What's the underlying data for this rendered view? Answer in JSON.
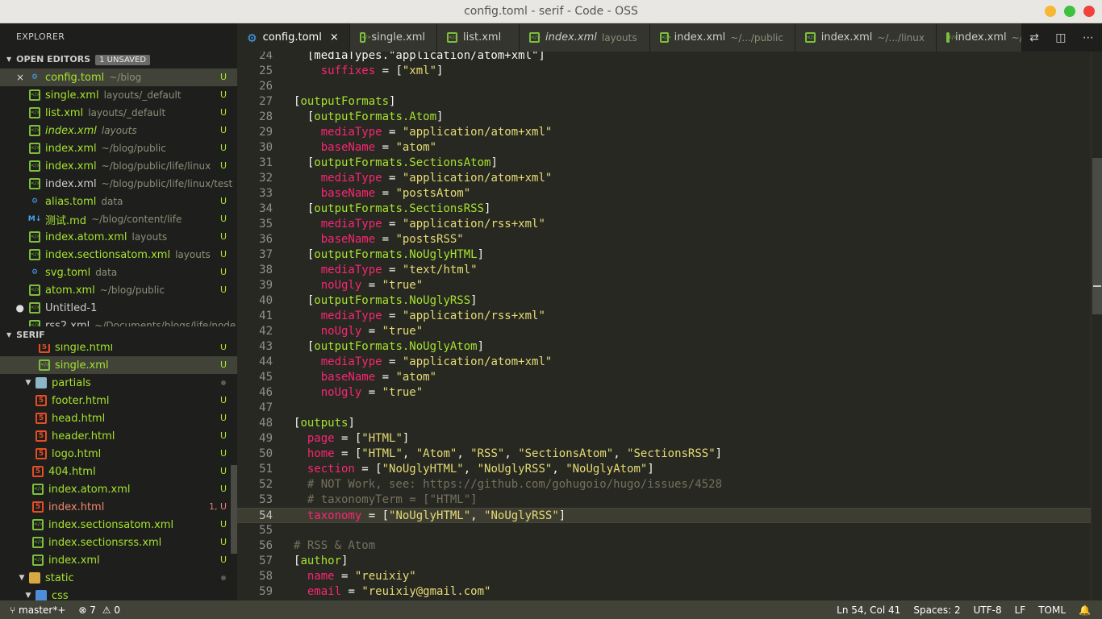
{
  "window": {
    "title": "config.toml - serif - Code - OSS",
    "buttons": {
      "minimize_color": "#f7b733",
      "maximize_color": "#3ec13e",
      "close_color": "#f0413d"
    }
  },
  "sidebar": {
    "title": "EXPLORER",
    "open_editors": {
      "label": "OPEN EDITORS",
      "badge": "1 UNSAVED",
      "items": [
        {
          "name": "config.toml",
          "desc": "~/blog",
          "status": "U",
          "icon": "gear-icon",
          "lead": "×"
        },
        {
          "name": "single.xml",
          "desc": "layouts/_default",
          "status": "U",
          "icon": "xml-icon",
          "lead": ""
        },
        {
          "name": "list.xml",
          "desc": "layouts/_default",
          "status": "U",
          "icon": "xml-icon",
          "lead": ""
        },
        {
          "name": "index.xml",
          "desc": "layouts",
          "status": "U",
          "icon": "xml-icon",
          "lead": ""
        },
        {
          "name": "index.xml",
          "desc": "~/blog/public",
          "status": "U",
          "icon": "xml-icon",
          "lead": ""
        },
        {
          "name": "index.xml",
          "desc": "~/blog/public/life/linux",
          "status": "U",
          "icon": "xml-icon",
          "lead": ""
        },
        {
          "name": "index.xml",
          "desc": "~/blog/public/life/linux/test",
          "status": "",
          "icon": "xml-icon",
          "lead": ""
        },
        {
          "name": "alias.toml",
          "desc": "data",
          "status": "U",
          "icon": "gear-icon",
          "lead": ""
        },
        {
          "name": "测试.md",
          "desc": "~/blog/content/life",
          "status": "U",
          "icon": "markdown-icon",
          "lead": ""
        },
        {
          "name": "index.atom.xml",
          "desc": "layouts",
          "status": "U",
          "icon": "xml-icon",
          "lead": ""
        },
        {
          "name": "index.sectionsatom.xml",
          "desc": "layouts",
          "status": "U",
          "icon": "xml-icon",
          "lead": ""
        },
        {
          "name": "svg.toml",
          "desc": "data",
          "status": "U",
          "icon": "gear-icon",
          "lead": ""
        },
        {
          "name": "atom.xml",
          "desc": "~/blog/public",
          "status": "U",
          "icon": "xml-icon",
          "lead": ""
        },
        {
          "name": "Untitled-1",
          "desc": "",
          "status": "",
          "icon": "xml-icon",
          "lead": "●"
        },
        {
          "name": "rss2.xml",
          "desc": "~/Documents/blogs/life/node_m",
          "status": "",
          "icon": "xml-icon",
          "lead": ""
        }
      ]
    },
    "project": {
      "label": "SERIF",
      "items": [
        {
          "name": "single.html",
          "status": "U",
          "type": "html"
        },
        {
          "name": "single.xml",
          "status": "U",
          "type": "xml"
        },
        {
          "name": "partials",
          "status": "",
          "type": "folder"
        },
        {
          "name": "footer.html",
          "status": "U",
          "type": "html"
        },
        {
          "name": "head.html",
          "status": "U",
          "type": "html"
        },
        {
          "name": "header.html",
          "status": "U",
          "type": "html"
        },
        {
          "name": "logo.html",
          "status": "U",
          "type": "html"
        },
        {
          "name": "404.html",
          "status": "U",
          "type": "html"
        },
        {
          "name": "index.atom.xml",
          "status": "U",
          "type": "xml"
        },
        {
          "name": "index.html",
          "status": "1, U",
          "type": "html"
        },
        {
          "name": "index.sectionsatom.xml",
          "status": "U",
          "type": "xml"
        },
        {
          "name": "index.sectionsrss.xml",
          "status": "U",
          "type": "xml"
        },
        {
          "name": "index.xml",
          "status": "U",
          "type": "xml"
        },
        {
          "name": "static",
          "status": "",
          "type": "folder"
        },
        {
          "name": "css",
          "status": "",
          "type": "folder"
        }
      ]
    }
  },
  "tabs": [
    {
      "name": "config.toml",
      "desc": "",
      "icon": "gear-icon",
      "close": "×"
    },
    {
      "name": "single.xml",
      "desc": "",
      "icon": "xml-icon"
    },
    {
      "name": "list.xml",
      "desc": "",
      "icon": "xml-icon"
    },
    {
      "name": "index.xml",
      "desc": "layouts",
      "icon": "xml-icon"
    },
    {
      "name": "index.xml",
      "desc": "~/.../public",
      "icon": "xml-icon"
    },
    {
      "name": "index.xml",
      "desc": "~/.../linux",
      "icon": "xml-icon"
    },
    {
      "name": "index.xml",
      "desc": "~/",
      "icon": "xml-icon"
    }
  ],
  "editor": {
    "first_line": 24,
    "current_line": 54,
    "lines": [
      [
        {
          "t": "  [mediaTypes.\"application/atom+xml\"]",
          "c": "p"
        }
      ],
      [
        {
          "t": "    ",
          "c": "p"
        },
        {
          "t": "suffixes",
          "c": "k"
        },
        {
          "t": " = [",
          "c": "p"
        },
        {
          "t": "\"xml\"",
          "c": "s"
        },
        {
          "t": "]",
          "c": "p"
        }
      ],
      [],
      [
        {
          "t": "[",
          "c": "p"
        },
        {
          "t": "outputFormats",
          "c": "h"
        },
        {
          "t": "]",
          "c": "p"
        }
      ],
      [
        {
          "t": "  [",
          "c": "p"
        },
        {
          "t": "outputFormats.Atom",
          "c": "h"
        },
        {
          "t": "]",
          "c": "p"
        }
      ],
      [
        {
          "t": "    ",
          "c": "p"
        },
        {
          "t": "mediaType",
          "c": "k"
        },
        {
          "t": " = ",
          "c": "p"
        },
        {
          "t": "\"application/atom+xml\"",
          "c": "s"
        }
      ],
      [
        {
          "t": "    ",
          "c": "p"
        },
        {
          "t": "baseName",
          "c": "k"
        },
        {
          "t": " = ",
          "c": "p"
        },
        {
          "t": "\"atom\"",
          "c": "s"
        }
      ],
      [
        {
          "t": "  [",
          "c": "p"
        },
        {
          "t": "outputFormats.SectionsAtom",
          "c": "h"
        },
        {
          "t": "]",
          "c": "p"
        }
      ],
      [
        {
          "t": "    ",
          "c": "p"
        },
        {
          "t": "mediaType",
          "c": "k"
        },
        {
          "t": " = ",
          "c": "p"
        },
        {
          "t": "\"application/atom+xml\"",
          "c": "s"
        }
      ],
      [
        {
          "t": "    ",
          "c": "p"
        },
        {
          "t": "baseName",
          "c": "k"
        },
        {
          "t": " = ",
          "c": "p"
        },
        {
          "t": "\"postsAtom\"",
          "c": "s"
        }
      ],
      [
        {
          "t": "  [",
          "c": "p"
        },
        {
          "t": "outputFormats.SectionsRSS",
          "c": "h"
        },
        {
          "t": "]",
          "c": "p"
        }
      ],
      [
        {
          "t": "    ",
          "c": "p"
        },
        {
          "t": "mediaType",
          "c": "k"
        },
        {
          "t": " = ",
          "c": "p"
        },
        {
          "t": "\"application/rss+xml\"",
          "c": "s"
        }
      ],
      [
        {
          "t": "    ",
          "c": "p"
        },
        {
          "t": "baseName",
          "c": "k"
        },
        {
          "t": " = ",
          "c": "p"
        },
        {
          "t": "\"postsRSS\"",
          "c": "s"
        }
      ],
      [
        {
          "t": "  [",
          "c": "p"
        },
        {
          "t": "outputFormats.NoUglyHTML",
          "c": "h"
        },
        {
          "t": "]",
          "c": "p"
        }
      ],
      [
        {
          "t": "    ",
          "c": "p"
        },
        {
          "t": "mediaType",
          "c": "k"
        },
        {
          "t": " = ",
          "c": "p"
        },
        {
          "t": "\"text/html\"",
          "c": "s"
        }
      ],
      [
        {
          "t": "    ",
          "c": "p"
        },
        {
          "t": "noUgly",
          "c": "k"
        },
        {
          "t": " = ",
          "c": "p"
        },
        {
          "t": "\"true\"",
          "c": "s"
        }
      ],
      [
        {
          "t": "  [",
          "c": "p"
        },
        {
          "t": "outputFormats.NoUglyRSS",
          "c": "h"
        },
        {
          "t": "]",
          "c": "p"
        }
      ],
      [
        {
          "t": "    ",
          "c": "p"
        },
        {
          "t": "mediaType",
          "c": "k"
        },
        {
          "t": " = ",
          "c": "p"
        },
        {
          "t": "\"application/rss+xml\"",
          "c": "s"
        }
      ],
      [
        {
          "t": "    ",
          "c": "p"
        },
        {
          "t": "noUgly",
          "c": "k"
        },
        {
          "t": " = ",
          "c": "p"
        },
        {
          "t": "\"true\"",
          "c": "s"
        }
      ],
      [
        {
          "t": "  [",
          "c": "p"
        },
        {
          "t": "outputFormats.NoUglyAtom",
          "c": "h"
        },
        {
          "t": "]",
          "c": "p"
        }
      ],
      [
        {
          "t": "    ",
          "c": "p"
        },
        {
          "t": "mediaType",
          "c": "k"
        },
        {
          "t": " = ",
          "c": "p"
        },
        {
          "t": "\"application/atom+xml\"",
          "c": "s"
        }
      ],
      [
        {
          "t": "    ",
          "c": "p"
        },
        {
          "t": "baseName",
          "c": "k"
        },
        {
          "t": " = ",
          "c": "p"
        },
        {
          "t": "\"atom\"",
          "c": "s"
        }
      ],
      [
        {
          "t": "    ",
          "c": "p"
        },
        {
          "t": "noUgly",
          "c": "k"
        },
        {
          "t": " = ",
          "c": "p"
        },
        {
          "t": "\"true\"",
          "c": "s"
        }
      ],
      [],
      [
        {
          "t": "[",
          "c": "p"
        },
        {
          "t": "outputs",
          "c": "h"
        },
        {
          "t": "]",
          "c": "p"
        }
      ],
      [
        {
          "t": "  ",
          "c": "p"
        },
        {
          "t": "page",
          "c": "k"
        },
        {
          "t": " = [",
          "c": "p"
        },
        {
          "t": "\"HTML\"",
          "c": "s"
        },
        {
          "t": "]",
          "c": "p"
        }
      ],
      [
        {
          "t": "  ",
          "c": "p"
        },
        {
          "t": "home",
          "c": "k"
        },
        {
          "t": " = [",
          "c": "p"
        },
        {
          "t": "\"HTML\"",
          "c": "s"
        },
        {
          "t": ", ",
          "c": "p"
        },
        {
          "t": "\"Atom\"",
          "c": "s"
        },
        {
          "t": ", ",
          "c": "p"
        },
        {
          "t": "\"RSS\"",
          "c": "s"
        },
        {
          "t": ", ",
          "c": "p"
        },
        {
          "t": "\"SectionsAtom\"",
          "c": "s"
        },
        {
          "t": ", ",
          "c": "p"
        },
        {
          "t": "\"SectionsRSS\"",
          "c": "s"
        },
        {
          "t": "]",
          "c": "p"
        }
      ],
      [
        {
          "t": "  ",
          "c": "p"
        },
        {
          "t": "section",
          "c": "k"
        },
        {
          "t": " = [",
          "c": "p"
        },
        {
          "t": "\"NoUglyHTML\"",
          "c": "s"
        },
        {
          "t": ", ",
          "c": "p"
        },
        {
          "t": "\"NoUglyRSS\"",
          "c": "s"
        },
        {
          "t": ", ",
          "c": "p"
        },
        {
          "t": "\"NoUglyAtom\"",
          "c": "s"
        },
        {
          "t": "]",
          "c": "p"
        }
      ],
      [
        {
          "t": "  # NOT Work, see: https://github.com/gohugoio/hugo/issues/4528",
          "c": "c"
        }
      ],
      [
        {
          "t": "  # taxonomyTerm = [\"HTML\"]",
          "c": "c"
        }
      ],
      [
        {
          "t": "  ",
          "c": "p"
        },
        {
          "t": "taxonomy",
          "c": "k"
        },
        {
          "t": " = [",
          "c": "p"
        },
        {
          "t": "\"NoUglyHTML\"",
          "c": "s"
        },
        {
          "t": ", ",
          "c": "p"
        },
        {
          "t": "\"NoUglyRSS\"",
          "c": "s"
        },
        {
          "t": "]",
          "c": "p"
        }
      ],
      [],
      [
        {
          "t": "# RSS & Atom",
          "c": "c"
        }
      ],
      [
        {
          "t": "[",
          "c": "p"
        },
        {
          "t": "author",
          "c": "h"
        },
        {
          "t": "]",
          "c": "p"
        }
      ],
      [
        {
          "t": "  ",
          "c": "p"
        },
        {
          "t": "name",
          "c": "k"
        },
        {
          "t": " = ",
          "c": "p"
        },
        {
          "t": "\"reuixiy\"",
          "c": "s"
        }
      ],
      [
        {
          "t": "  ",
          "c": "p"
        },
        {
          "t": "email",
          "c": "k"
        },
        {
          "t": " = ",
          "c": "p"
        },
        {
          "t": "\"reuixiy@gmail.com\"",
          "c": "s"
        }
      ],
      []
    ]
  },
  "statusbar": {
    "branch": "master*+",
    "errors": "7",
    "warnings": "0",
    "position": "Ln 54, Col 41",
    "spaces": "Spaces: 2",
    "encoding": "UTF-8",
    "eol": "LF",
    "language": "TOML",
    "bell_icon": "bell-icon"
  }
}
